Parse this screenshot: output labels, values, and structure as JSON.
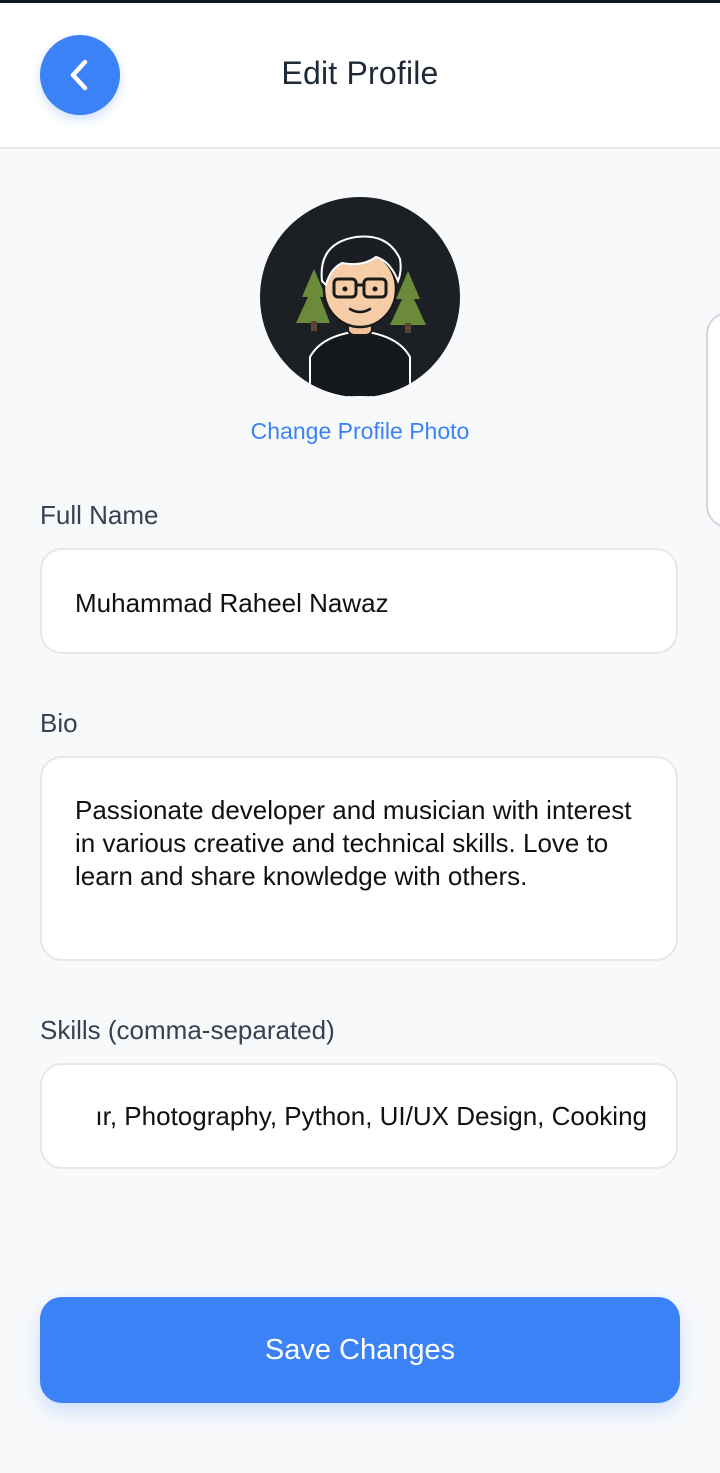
{
  "header": {
    "title": "Edit Profile",
    "back_icon": "chevron-left-icon"
  },
  "profile": {
    "avatar_icon": "cartoon-avatar-with-glasses",
    "change_photo_label": "Change Profile Photo"
  },
  "form": {
    "full_name": {
      "label": "Full Name",
      "value": "Muhammad Raheel Nawaz"
    },
    "bio": {
      "label": "Bio",
      "value": "Passionate developer and musician with interest in various creative and technical skills. Love to learn and share knowledge with others."
    },
    "skills": {
      "label": "Skills (comma-separated)",
      "visible_value": "ır, Photography, Python, UI/UX Design, Cooking"
    }
  },
  "actions": {
    "save_label": "Save Changes"
  },
  "colors": {
    "accent": "#3b82f6",
    "background": "#f7f9fb",
    "surface": "#ffffff",
    "border": "#e5e7eb"
  }
}
